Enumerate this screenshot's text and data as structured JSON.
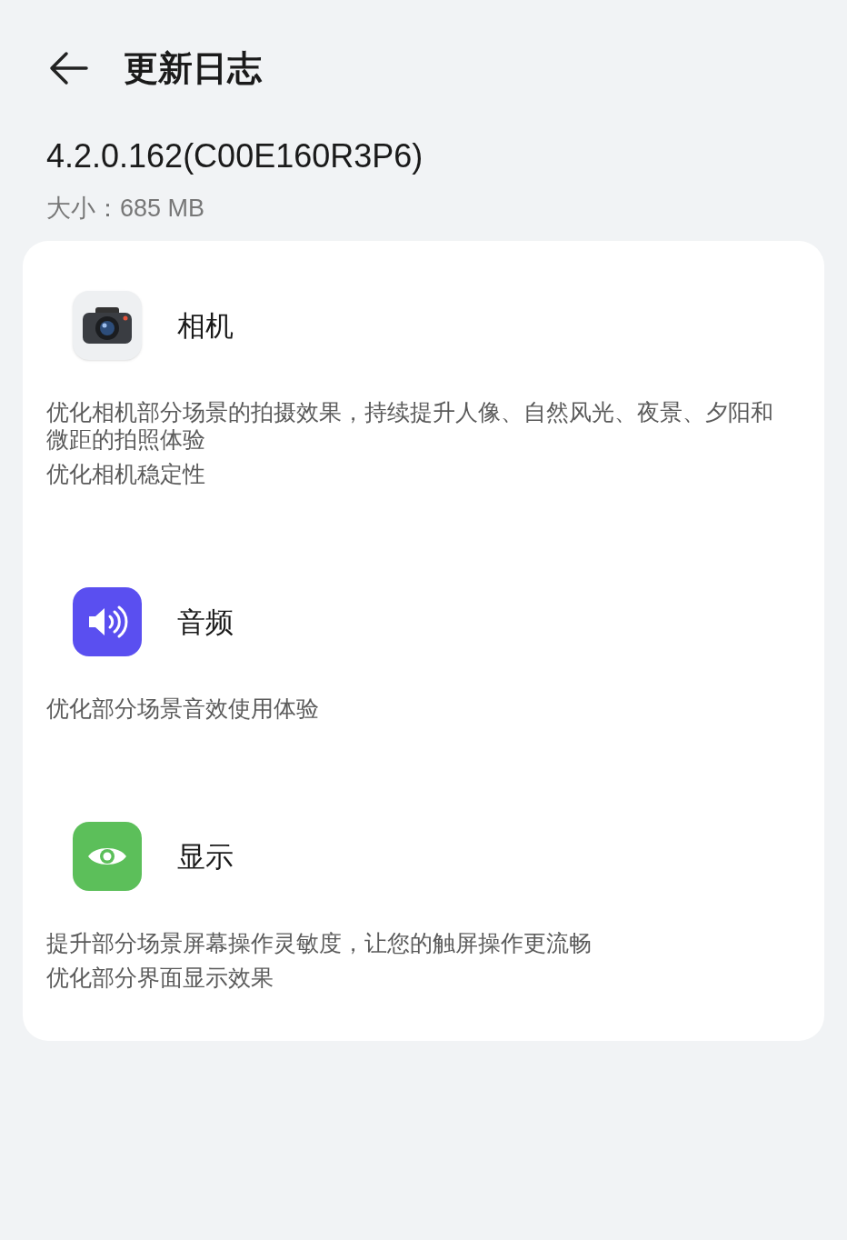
{
  "header": {
    "title": "更新日志"
  },
  "version": "4.2.0.162(C00E160R3P6)",
  "size": "大小：685 MB",
  "sections": [
    {
      "kind": "camera",
      "title": "相机",
      "notes": [
        "优化相机部分场景的拍摄效果，持续提升人像、自然风光、夜景、夕阳和微距的拍照体验",
        "优化相机稳定性"
      ]
    },
    {
      "kind": "audio",
      "title": "音频",
      "notes": [
        "优化部分场景音效使用体验"
      ]
    },
    {
      "kind": "display",
      "title": "显示",
      "notes": [
        "提升部分场景屏幕操作灵敏度，让您的触屏操作更流畅",
        "优化部分界面显示效果"
      ]
    }
  ]
}
